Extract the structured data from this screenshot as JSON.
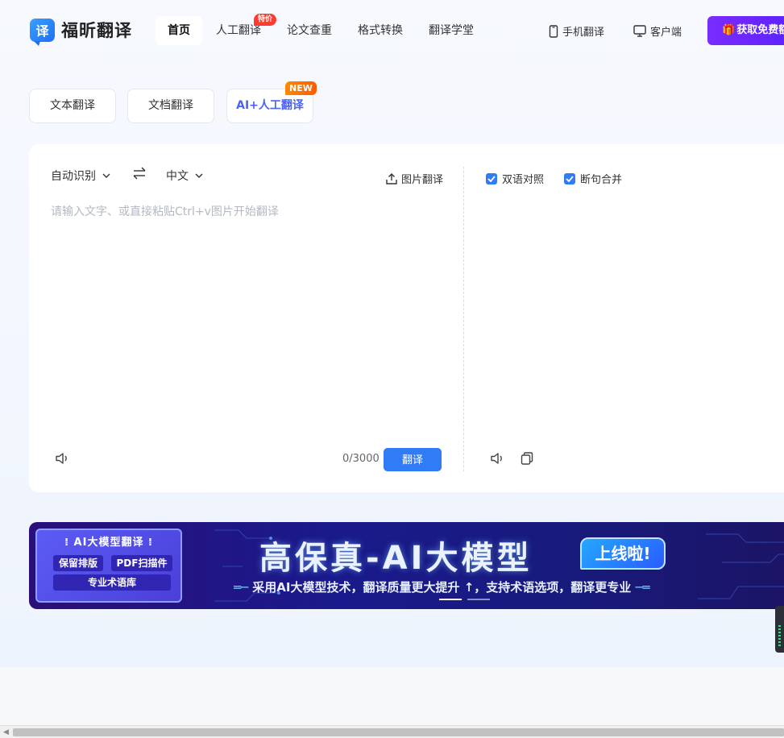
{
  "header": {
    "logo_glyph": "译",
    "logo_text": "福昕翻译",
    "nav": [
      {
        "label": "首页",
        "active": true
      },
      {
        "label": "人工翻译",
        "badge": "特价"
      },
      {
        "label": "论文查重"
      },
      {
        "label": "格式转换"
      },
      {
        "label": "翻译学堂"
      }
    ],
    "mobile_label": "手机翻译",
    "client_label": "客户端",
    "vip_label": "获取免费额度"
  },
  "modes": {
    "text": "文本翻译",
    "document": "文档翻译",
    "ai_human": "AI+人工翻译",
    "new_badge": "NEW"
  },
  "translator": {
    "source_lang": "自动识别",
    "target_lang": "中文",
    "image_translate": "图片翻译",
    "placeholder": "请输入文字、或直接粘贴Ctrl+v图片开始翻译",
    "char_count": "0/3000",
    "translate_button": "翻译",
    "bilingual_label": "双语对照",
    "merge_label": "断句合并",
    "bilingual_checked": true,
    "merge_checked": true
  },
  "banner": {
    "feature_title": "AI大模型翻译",
    "feature_chips": [
      "保留排版",
      "PDF扫描件",
      "专业术语库"
    ],
    "title": "高保真-AI大模型",
    "badge": "上线啦!",
    "subtitle": "采用AI大模型技术，翻译质量更大提升 ↑，支持术语选项，翻译更专业",
    "active_slide": 1,
    "slide_count": 2
  },
  "colors": {
    "primary": "#2f7cf6",
    "vip": "#6a27ff",
    "hot_badge": "#ff3b30",
    "new_badge": "#ff7a00"
  }
}
